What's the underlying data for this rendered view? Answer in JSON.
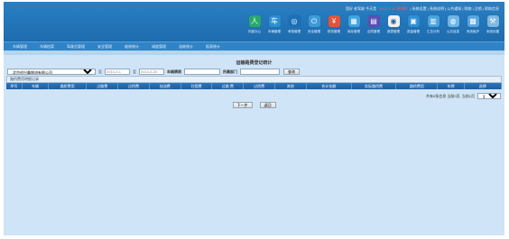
{
  "top_links": [
    {
      "text": "您好 老驾驶 今天是",
      "red": false
    },
    {
      "text": "2022-3-10 星期四",
      "red": true
    },
    {
      "text": "| 系统设置 | 系统说明 | 公共通知 | 购物 | 注销 | 帮助信息",
      "red": false
    }
  ],
  "toolbar": [
    {
      "label": "内部办公",
      "color": "#2aa86b",
      "glyph": "人"
    },
    {
      "label": "车辆管理",
      "color": "#2b8fd1",
      "glyph": "车"
    },
    {
      "label": "考核管理",
      "color": "#1a6fb6",
      "glyph": "◎"
    },
    {
      "label": "安全管理",
      "color": "#3e9ad7",
      "glyph": "⏻"
    },
    {
      "label": "财务管理",
      "color": "#e2543a",
      "glyph": "¥"
    },
    {
      "label": "库存管理",
      "color": "#3fa4e0",
      "glyph": "▦"
    },
    {
      "label": "合同管理",
      "color": "#5a4fb3",
      "glyph": "▤"
    },
    {
      "label": "报表管理",
      "color": "#f0f0f0",
      "glyph": "◉"
    },
    {
      "label": "质量管理",
      "color": "#2f8fd4",
      "glyph": "▣"
    },
    {
      "label": "汇总分析",
      "color": "#4ba3dd",
      "glyph": "▥"
    },
    {
      "label": "公共信息",
      "color": "#6eb5e6",
      "glyph": "◍"
    },
    {
      "label": "系统维护",
      "color": "#5aa6df",
      "glyph": "▩"
    },
    {
      "label": "系统设置",
      "color": "#7fb8e3",
      "glyph": "⚒"
    }
  ],
  "nav_items": [
    "车辆管理",
    "车辆档案",
    "驾驶员管理",
    "安全管理",
    "维修统计",
    "调度管理",
    "油耗统计",
    "报表统计"
  ],
  "page_title": "运输路费登记统计",
  "filters": {
    "company_value": "北京创兴鑫物流有限公司",
    "to_label": "至",
    "date_start": "2014-3-1",
    "date_mid_label": "至",
    "date_end": "2014-3-20",
    "plate_label": "车辆牌照",
    "plate_value": "",
    "dept_label": "所属部门",
    "dept_value": "",
    "query_label": "查询"
  },
  "table": {
    "title": "路桥费用明细记录",
    "columns": [
      "序号",
      "车辆",
      "路桥费用",
      "过路费",
      "过桥费",
      "加油费",
      "住宿费",
      "过路 费",
      "过桥费",
      "其他",
      "合计金额",
      "实际路桥费",
      "路桥费用",
      "车牌",
      "选择"
    ]
  },
  "pager": {
    "summary": "共有0条信息 当前0页, 当前1页",
    "page_option": "第1页"
  },
  "buttons": {
    "prev_label": "下一步",
    "back_label": "返回"
  }
}
